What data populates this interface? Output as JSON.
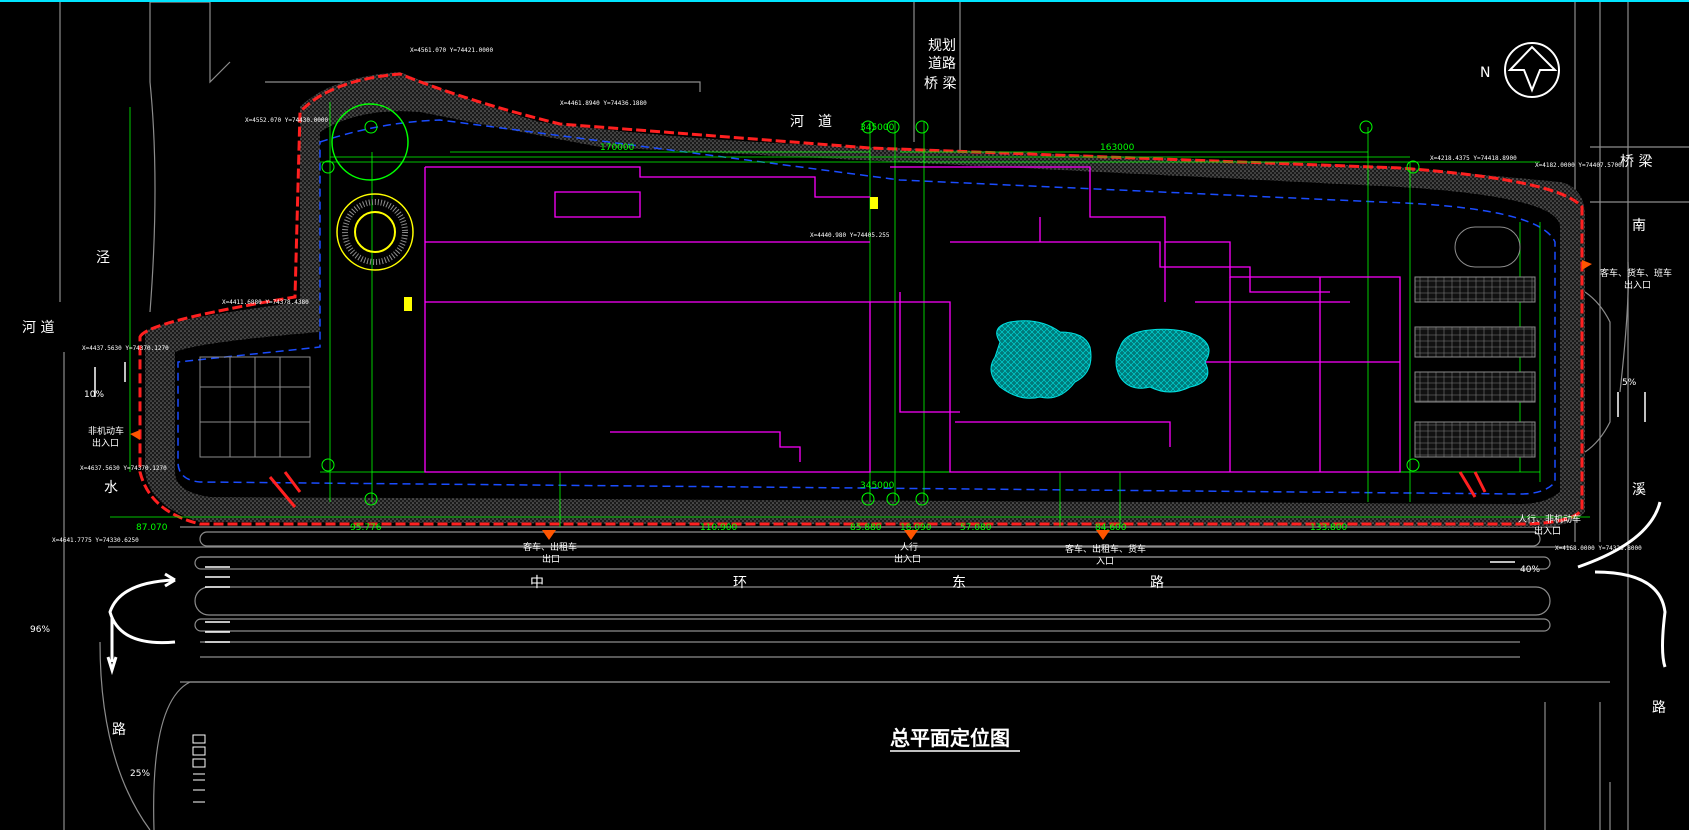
{
  "drawing": {
    "title": "总平面定位图",
    "north_label": "N",
    "colors": {
      "background": "#000000",
      "road": "#8c8c8c",
      "boundary": "#ff2020",
      "building": "#ff00ff",
      "green_line": "#00ff00",
      "water": "#00d8d8",
      "blue_dash": "#1a4cff",
      "yellow": "#ffff00",
      "hatch": "#6a6a6a"
    }
  },
  "labels": {
    "river_top": "河　道",
    "river_left": "河 道",
    "planned_road_1": "规划",
    "planned_road_2": "道路",
    "planned_road_3": "桥 梁",
    "bridge_right": "桥 梁",
    "left_road_1": "泾",
    "left_road_2": "水",
    "left_road_3": "路",
    "right_road_1": "南",
    "right_road_2": "溪",
    "right_road_3": "路",
    "main_road_1": "中",
    "main_road_2": "环",
    "main_road_3": "东",
    "main_road_4": "路",
    "gate_left_1": "非机动车",
    "gate_left_2": "出入口",
    "gate_bottom_left_1": "客车、出租车",
    "gate_bottom_left_2": "出口",
    "gate_bottom_mid_1": "人行",
    "gate_bottom_mid_2": "出入口",
    "gate_bottom_right_1": "客车、出租车、货车",
    "gate_bottom_right_2": "入口",
    "gate_right_1": "客车、货车、班车",
    "gate_right_2": "出入口",
    "gate_br_1": "人行、非机动车",
    "gate_br_2": "出入口",
    "pct_10": "10%",
    "pct_96": "96%",
    "pct_25": "25%",
    "pct_5": "5%",
    "pct_40": "40%"
  },
  "axes": [
    "V",
    "A",
    "H",
    "H",
    "H",
    "12",
    "12",
    "1",
    "1",
    "V",
    "A",
    "H",
    "H"
  ],
  "dimensions": [
    "87.070",
    "95.776",
    "110.900",
    "85.880",
    "18.090",
    "57.080",
    "84.600",
    "133.800",
    "170000",
    "163000",
    "345000",
    "345000"
  ],
  "coordinates": [
    "X=4561.070 Y=74421.0000",
    "X=4552.070 Y=74430.0000",
    "X=4461.8940 Y=74436.1880",
    "X=4411.6880 Y=74378.4380",
    "X=4437.5630 Y=74370.1270",
    "X=4637.5630 Y=74370.1270",
    "X=4641.7775 Y=74330.6250",
    "X=4218.4375 Y=74418.8900",
    "X=4182.0000 Y=74407.5700",
    "X=4168.0000 Y=74326.8000",
    "X=4440.980 Y=74405.255"
  ]
}
